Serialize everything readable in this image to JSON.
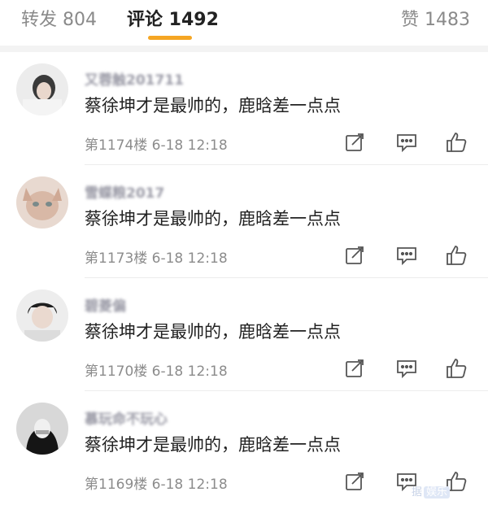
{
  "tabs": {
    "repost": "转发 804",
    "comments": "评论 1492",
    "likes": "赞 1483"
  },
  "colors": {
    "accent": "#f5a623",
    "muted": "#8c8c8c",
    "text": "#222222"
  },
  "comments": [
    {
      "username": "又蓉触201711",
      "text": "蔡徐坤才是最帅的，鹿晗差一点点",
      "meta": "第1174楼 6-18 12:18"
    },
    {
      "username": "雪蝶粮2017",
      "text": "蔡徐坤才是最帅的，鹿晗差一点点",
      "meta": "第1173楼 6-18 12:18"
    },
    {
      "username": "碧菱偏",
      "text": "蔡徐坤才是最帅的，鹿晗差一点点",
      "meta": "第1170楼 6-18 12:18"
    },
    {
      "username": "慕玩命不玩心",
      "text": "蔡徐坤才是最帅的，鹿晗差一点点",
      "meta": "第1169楼 6-18 12:18"
    }
  ],
  "icons": {
    "repost": "share-edit-icon",
    "comment": "comment-bubble-icon",
    "like": "thumbs-up-icon"
  },
  "watermark": {
    "text": "据",
    "tag": "娱乐"
  }
}
